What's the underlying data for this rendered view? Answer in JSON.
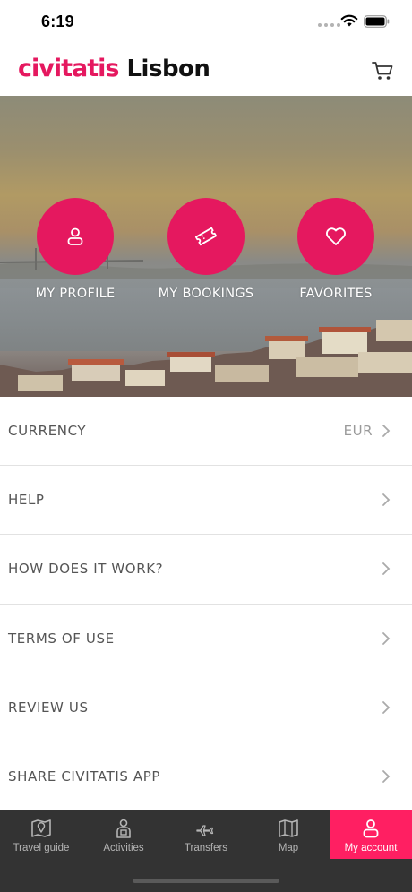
{
  "status_bar": {
    "time": "6:19"
  },
  "header": {
    "brand": "civitatis",
    "city": "Lisbon",
    "cart_icon": "shopping-cart-icon"
  },
  "hero": {
    "actions": [
      {
        "label": "MY PROFILE",
        "icon": "user-icon"
      },
      {
        "label": "MY BOOKINGS",
        "icon": "ticket-icon"
      },
      {
        "label": "FAVORITES",
        "icon": "heart-icon"
      }
    ]
  },
  "menu": {
    "items": [
      {
        "label": "CURRENCY",
        "value": "EUR"
      },
      {
        "label": "HELP"
      },
      {
        "label": "HOW DOES IT WORK?"
      },
      {
        "label": "TERMS OF USE"
      },
      {
        "label": "REVIEW US"
      },
      {
        "label": "SHARE CIVITATIS APP"
      }
    ]
  },
  "tab_bar": {
    "tabs": [
      {
        "label": "Travel guide",
        "icon": "map-pin-icon"
      },
      {
        "label": "Activities",
        "icon": "guide-icon"
      },
      {
        "label": "Transfers",
        "icon": "airplane-icon"
      },
      {
        "label": "Map",
        "icon": "map-icon"
      },
      {
        "label": "My account",
        "icon": "user-icon",
        "active": true
      }
    ]
  },
  "colors": {
    "accent": "#e5185f",
    "tab_bar_bg": "#333333",
    "tab_active": "#ff1f62"
  }
}
